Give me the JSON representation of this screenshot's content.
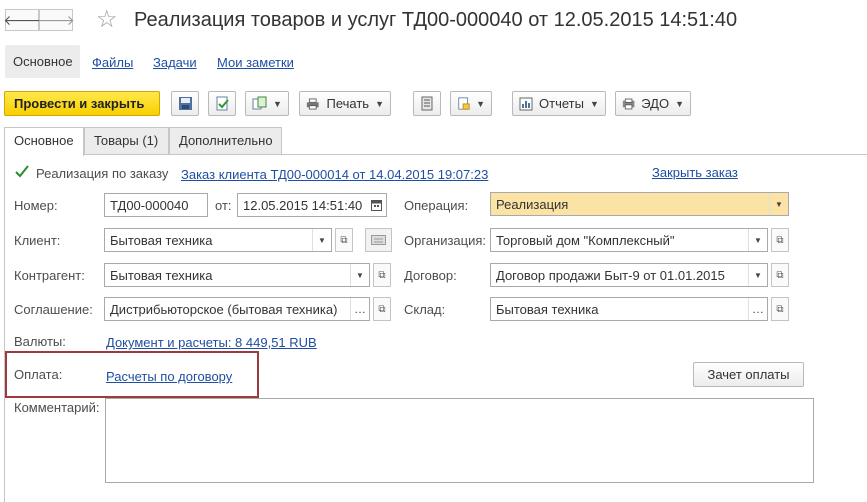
{
  "window": {
    "title": "Реализация товаров и услуг ТД00-000040 от 12.05.2015 14:51:40",
    "back_glyph": "🡐",
    "forward_glyph": "🡒",
    "star_glyph": "☆"
  },
  "nav_tabs": [
    {
      "label": "Основное",
      "active": true
    },
    {
      "label": "Файлы"
    },
    {
      "label": "Задачи"
    },
    {
      "label": "Мои заметки"
    }
  ],
  "toolbar": {
    "post_and_close": "Провести и закрыть",
    "print": "Печать",
    "reports": "Отчеты",
    "edo": "ЭДО"
  },
  "tabs": [
    {
      "label": "Основное",
      "active": true
    },
    {
      "label": "Товары (1)"
    },
    {
      "label": "Дополнительно"
    }
  ],
  "form": {
    "by_order_label": "Реализация по заказу",
    "by_order_checked": true,
    "order_link": "Заказ клиента ТД00-000014 от 14.04.2015 19:07:23",
    "close_order": "Закрыть заказ",
    "number_label": "Номер:",
    "number_value": "ТД00-000040",
    "date_label": "от:",
    "date_value": "12.05.2015 14:51:40",
    "operation_label": "Операция:",
    "operation_value": "Реализация",
    "client_label": "Клиент:",
    "client_value": "Бытовая техника",
    "organization_label": "Организация:",
    "organization_value": "Торговый дом \"Комплексный\"",
    "counterparty_label": "Контрагент:",
    "counterparty_value": "Бытовая техника",
    "contract_label": "Договор:",
    "contract_value": "Договор продажи Быт-9 от 01.01.2015",
    "agreement_label": "Соглашение:",
    "agreement_value": "Дистрибьюторское (бытовая техника)",
    "warehouse_label": "Склад:",
    "warehouse_value": "Бытовая техника",
    "currency_label": "Валюты:",
    "currency_link": "Документ и расчеты: 8 449,51 RUB",
    "payment_label": "Оплата:",
    "payment_link": "Расчеты по договору",
    "offset_button": "Зачет оплаты",
    "comment_label": "Комментарий:",
    "comment_value": ""
  },
  "colors": {
    "primary_button": "#f8cf00",
    "operation_field": "#fbe3a5",
    "highlight_box": "#9b3a3f",
    "link": "#1f4fa3"
  }
}
